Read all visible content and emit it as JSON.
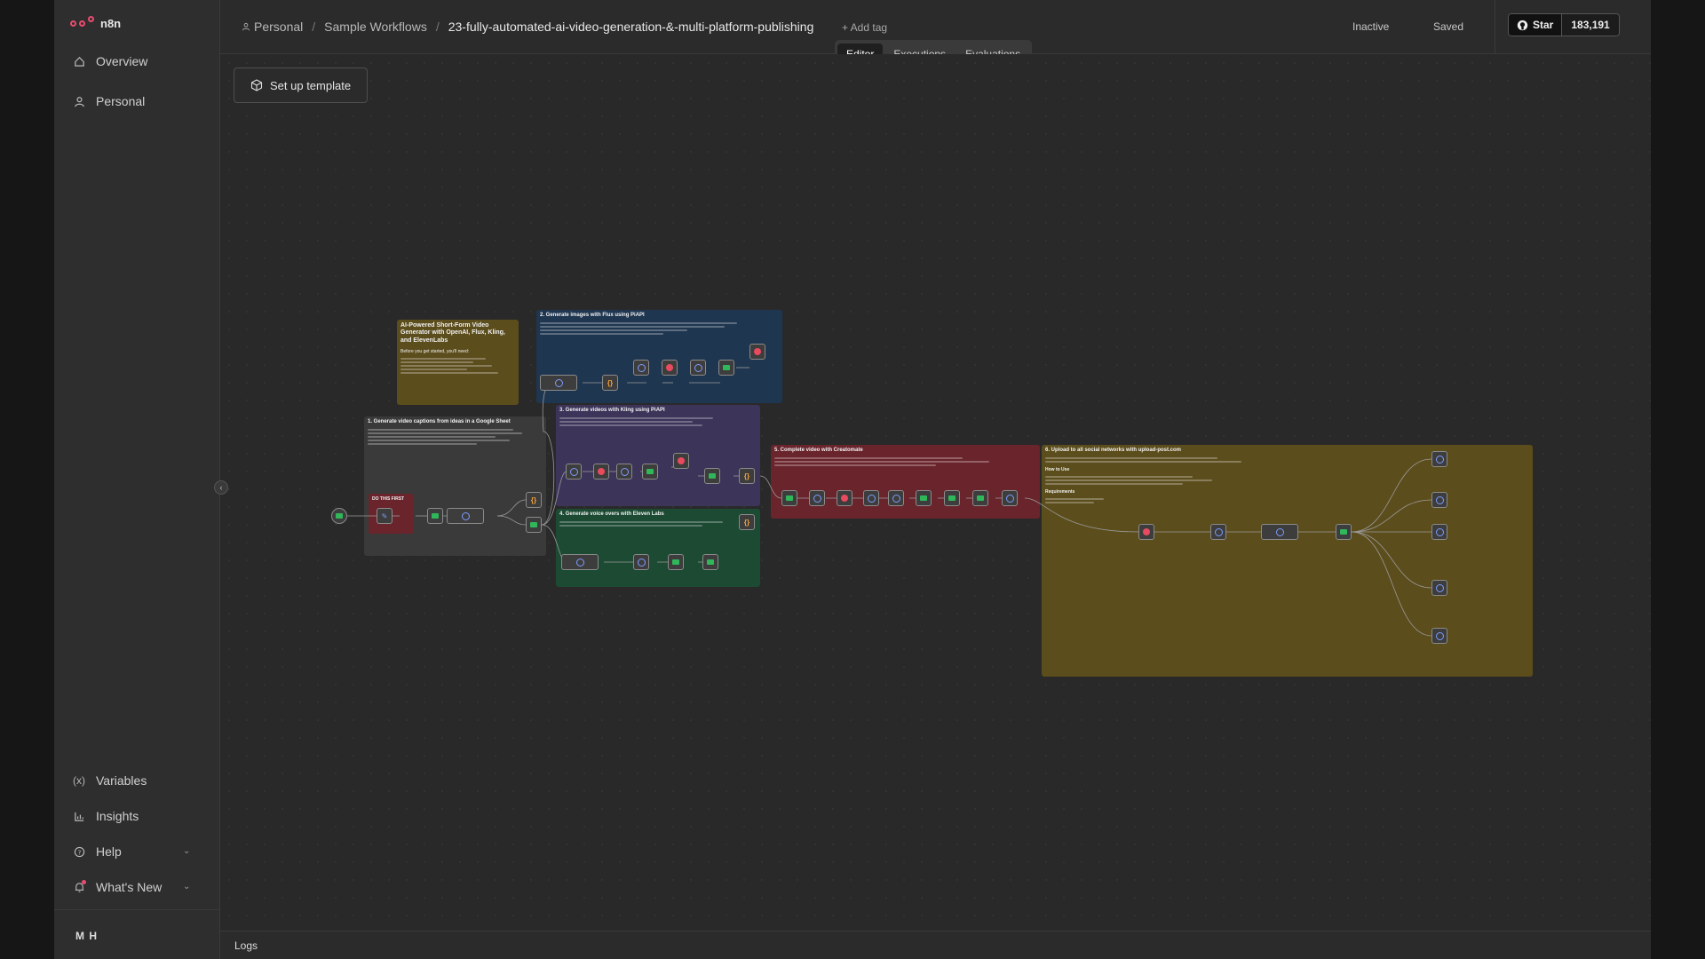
{
  "app": {
    "logo_text": "n8n"
  },
  "sidebar": {
    "items": [
      {
        "label": "Overview",
        "icon": "home-icon"
      },
      {
        "label": "Personal",
        "icon": "user-icon"
      }
    ],
    "bottom_items": [
      {
        "label": "Variables",
        "icon": "variables-icon"
      },
      {
        "label": "Insights",
        "icon": "chart-icon"
      },
      {
        "label": "Help",
        "icon": "help-icon"
      },
      {
        "label": "What's New",
        "icon": "bell-icon"
      }
    ],
    "user_initials": "M H"
  },
  "header": {
    "breadcrumb": [
      "Personal",
      "Sample Workflows",
      "23-fully-automated-ai-video-generation-&-multi-platform-publishing"
    ],
    "add_tag": "+ Add tag",
    "status": "Inactive",
    "saved": "Saved",
    "github_star": "Star",
    "github_count": "183,191",
    "tabs": [
      "Editor",
      "Executions",
      "Evaluations"
    ],
    "active_tab": "Editor"
  },
  "canvas": {
    "setup_button": "Set up template",
    "stickies": {
      "intro": "AI-Powered Short-Form Video Generator with OpenAI, Flux, Kling, and ElevenLabs",
      "intro_sub": "Before you get started, you'll need:",
      "s1": "1. Generate video captions from ideas in a Google Sheet",
      "s1_badge": "DO THIS FIRST",
      "s2": "2. Generate images with Flux using PiAPI",
      "s3": "3. Generate videos with Kling using PiAPI",
      "s4": "4. Generate voice overs with Eleven Labs",
      "s5": "5. Complete video with Creatomate",
      "s6": "6. Upload to all social networks with upload-post.com",
      "s6_how": "How to Use",
      "s6_req": "Requirements"
    }
  },
  "logs": {
    "label": "Logs"
  },
  "colors": {
    "accent": "#ea4b71",
    "sticky_yellow": "#5c4d1c",
    "sticky_blue": "#1f3650",
    "sticky_purple": "#3c3459",
    "sticky_red": "#6a242c",
    "sticky_green": "#1c4a33",
    "sticky_grey": "#3a3a3a"
  }
}
